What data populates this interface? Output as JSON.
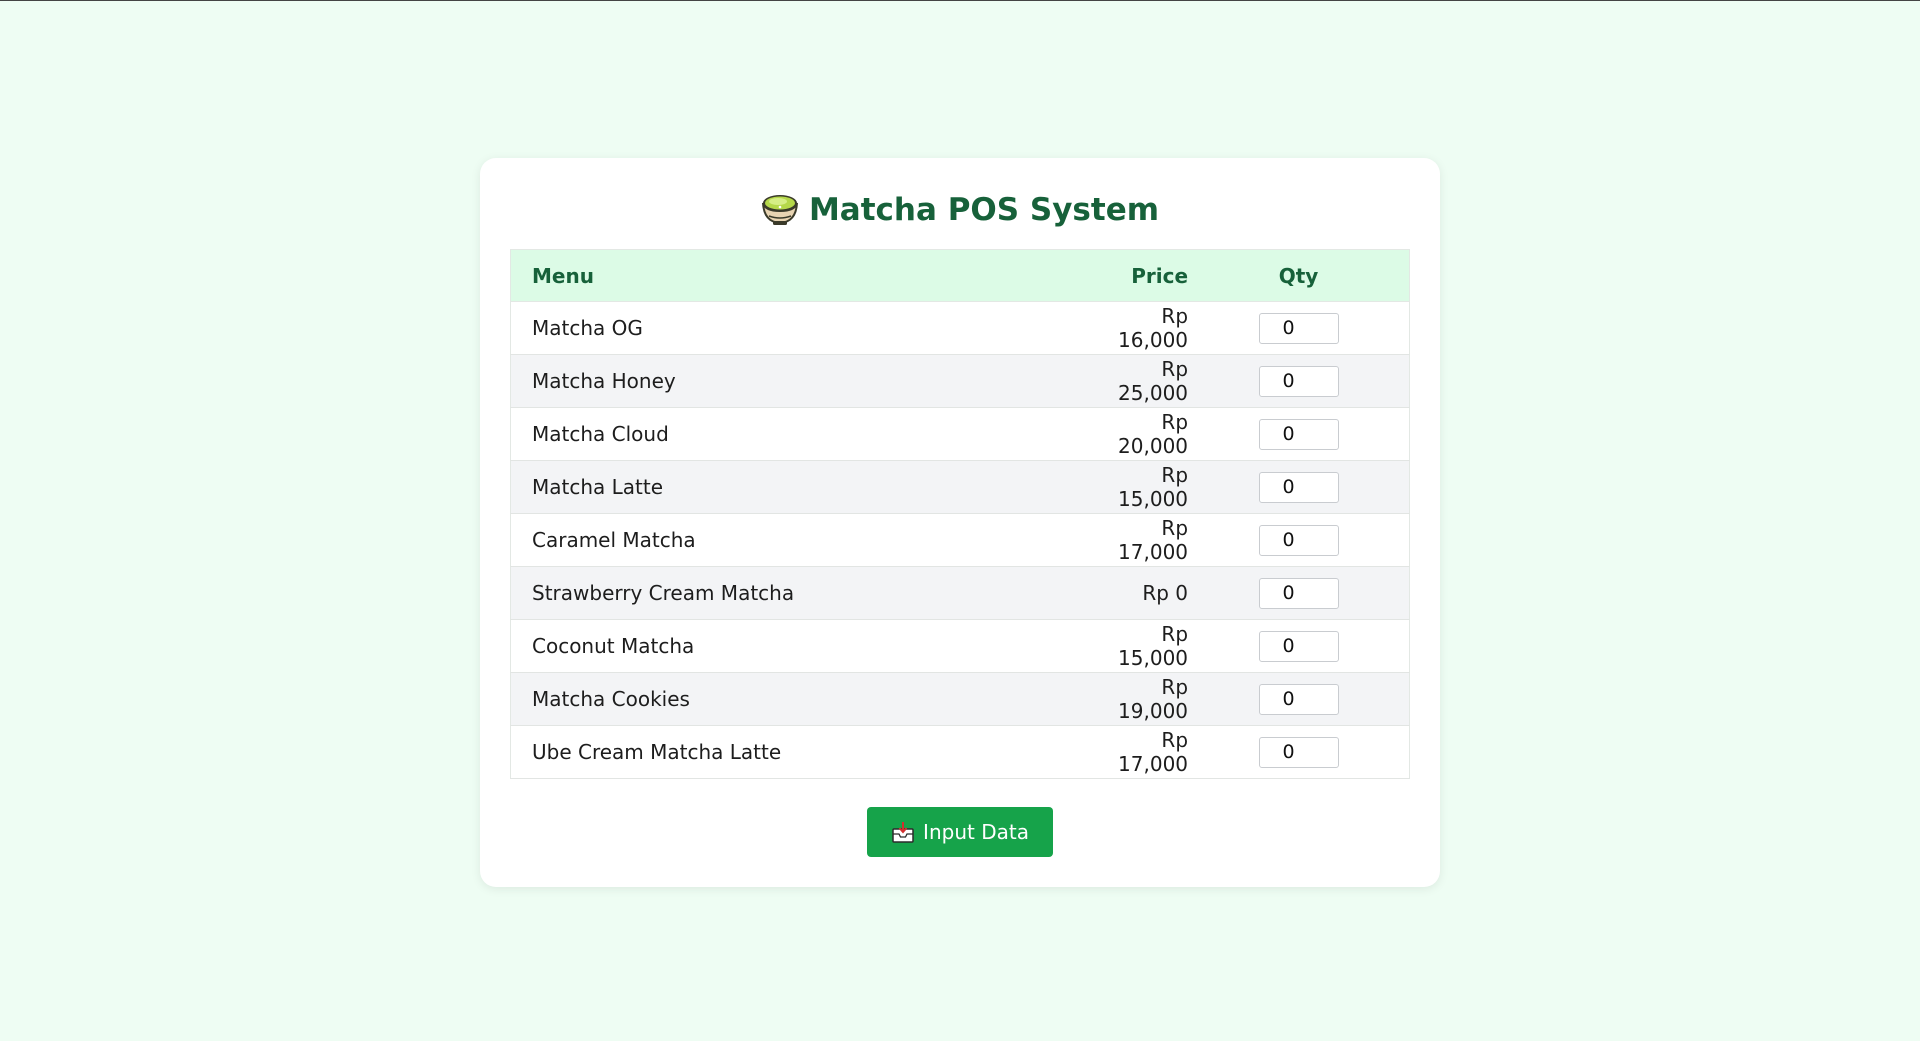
{
  "app": {
    "title": "Matcha POS System",
    "title_icon": "matcha-bowl-icon"
  },
  "table": {
    "headers": {
      "menu": "Menu",
      "price": "Price",
      "qty": "Qty"
    },
    "rows": [
      {
        "menu": "Matcha OG",
        "price": "Rp 16,000",
        "qty": "0"
      },
      {
        "menu": "Matcha Honey",
        "price": "Rp 25,000",
        "qty": "0"
      },
      {
        "menu": "Matcha Cloud",
        "price": "Rp 20,000",
        "qty": "0"
      },
      {
        "menu": "Matcha Latte",
        "price": "Rp 15,000",
        "qty": "0"
      },
      {
        "menu": "Caramel Matcha",
        "price": "Rp 17,000",
        "qty": "0"
      },
      {
        "menu": "Strawberry Cream Matcha",
        "price": "Rp 0",
        "qty": "0"
      },
      {
        "menu": "Coconut Matcha",
        "price": "Rp 15,000",
        "qty": "0"
      },
      {
        "menu": "Matcha Cookies",
        "price": "Rp 19,000",
        "qty": "0"
      },
      {
        "menu": "Ube Cream Matcha Latte",
        "price": "Rp 17,000",
        "qty": "0"
      }
    ]
  },
  "submit": {
    "label": "Input Data",
    "icon": "inbox-tray-icon"
  },
  "colors": {
    "background": "#eefdf3",
    "title": "#17613a",
    "header_bg": "#dcfbe6",
    "button": "#16a34a"
  }
}
